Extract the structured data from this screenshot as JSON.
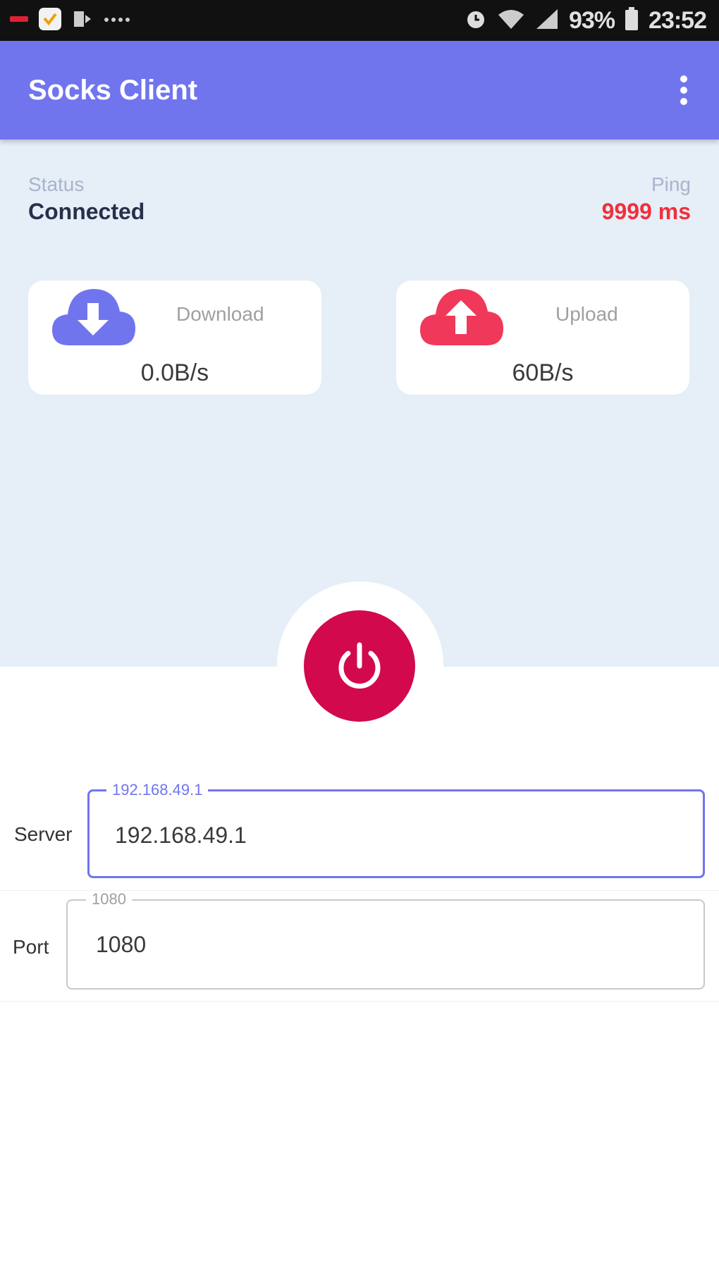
{
  "statusbar": {
    "battery": "93%",
    "time": "23:52",
    "icons": [
      "notification-icon",
      "app-icon",
      "cast-icon",
      "more-icon",
      "alarm-icon",
      "wifi-icon",
      "signal-icon",
      "battery-icon"
    ]
  },
  "appbar": {
    "title": "Socks Client",
    "menu_icon": "more-vert-icon",
    "color": "#7075EE"
  },
  "status": {
    "label": "Status",
    "value": "Connected"
  },
  "ping": {
    "label": "Ping",
    "value": "9999 ms",
    "color": "#F0303A"
  },
  "download": {
    "title": "Download",
    "speed": "0.0B/s",
    "icon": "cloud-download-icon",
    "color": "#7075EE"
  },
  "upload": {
    "title": "Upload",
    "speed": "60B/s",
    "icon": "cloud-upload-icon",
    "color": "#F0385A"
  },
  "power": {
    "icon": "power-icon",
    "color": "#D2094C"
  },
  "server": {
    "label": "Server",
    "hint": "192.168.49.1",
    "value": "192.168.49.1"
  },
  "port": {
    "label": "Port",
    "hint": "1080",
    "value": "1080"
  }
}
